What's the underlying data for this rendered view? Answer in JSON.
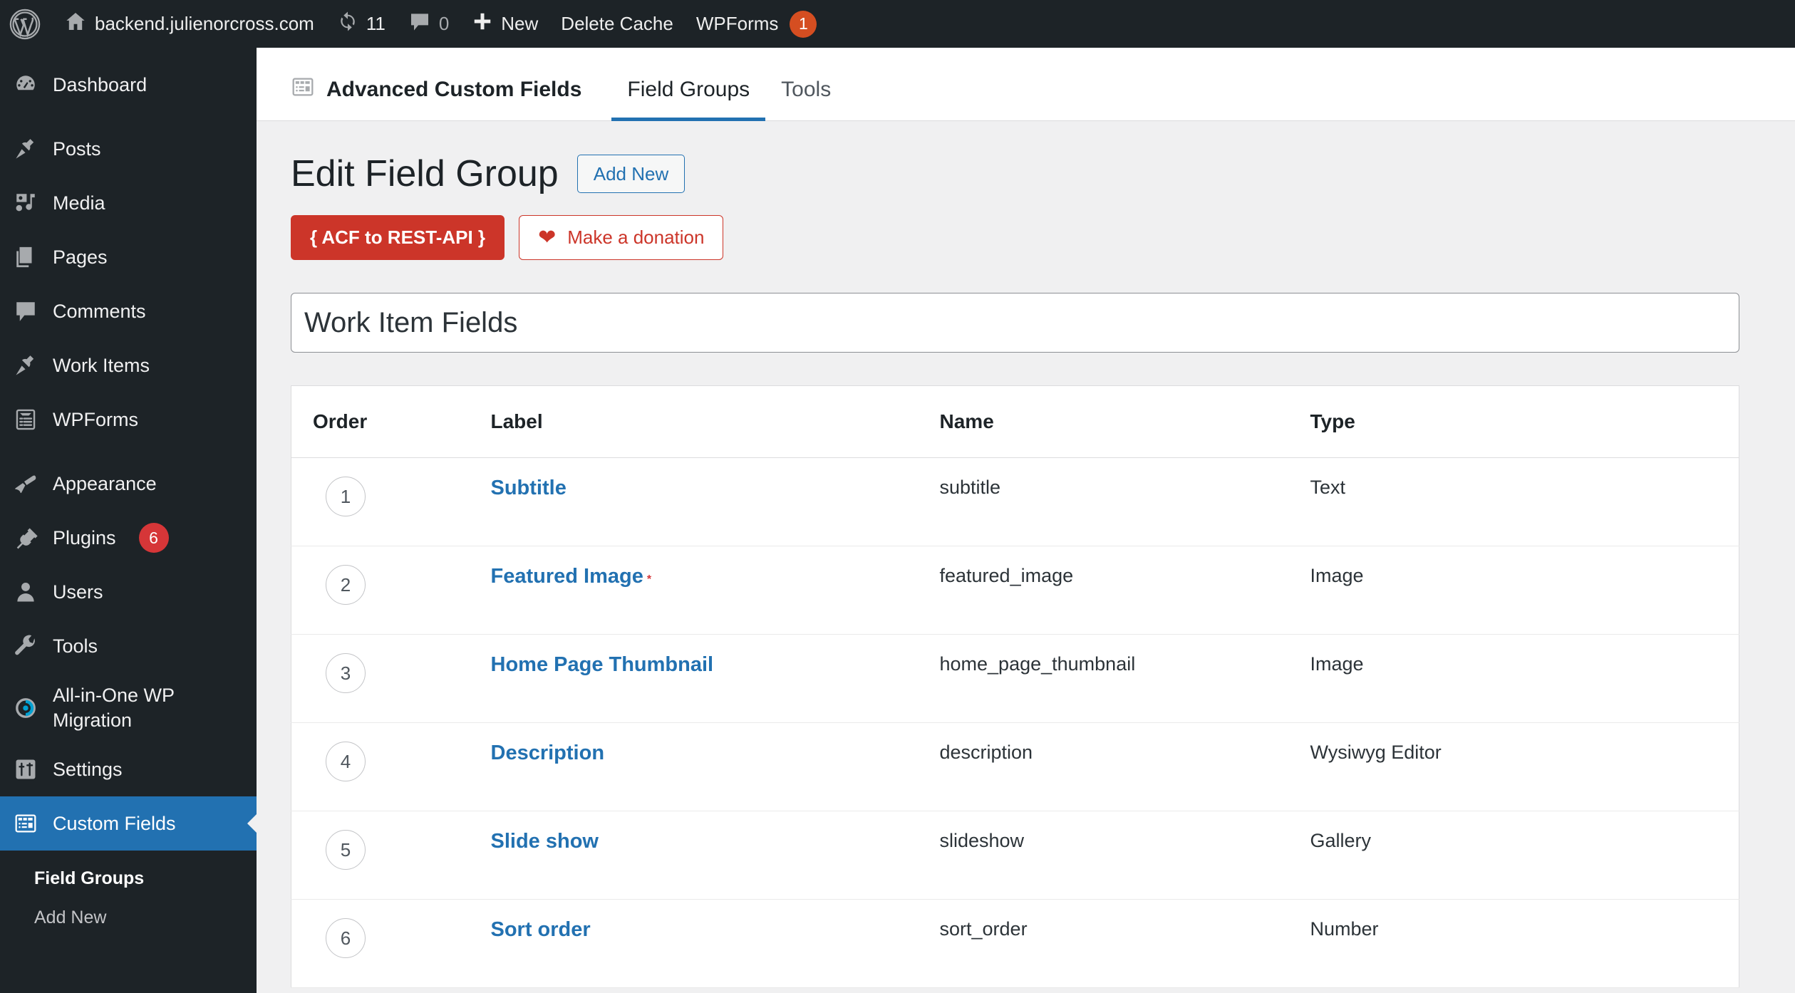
{
  "adminbar": {
    "wp_logo_icon": "wordpress-logo-icon",
    "site_home_icon": "home-icon",
    "site_name": "backend.julienorcross.com",
    "updates_icon": "updates-icon",
    "updates_count": "11",
    "comments_icon": "comment-bubble-icon",
    "comments_count": "0",
    "new_icon": "plus-icon",
    "new_label": "New",
    "delete_cache_label": "Delete Cache",
    "wpforms_label": "WPForms",
    "wpforms_badge": "1",
    "badge_color": "#d54e21"
  },
  "sidebar": {
    "items": [
      {
        "label": "Dashboard",
        "icon": "dashboard-gauge-icon"
      },
      {
        "label": "Posts",
        "icon": "pin-icon"
      },
      {
        "label": "Media",
        "icon": "media-icon"
      },
      {
        "label": "Pages",
        "icon": "pages-icon"
      },
      {
        "label": "Comments",
        "icon": "comment-bubble-icon"
      },
      {
        "label": "Work Items",
        "icon": "pin-icon"
      },
      {
        "label": "WPForms",
        "icon": "wpforms-clipboard-icon"
      },
      {
        "label": "Appearance",
        "icon": "paintbrush-icon"
      },
      {
        "label": "Plugins",
        "icon": "plug-icon",
        "badge": "6"
      },
      {
        "label": "Users",
        "icon": "user-icon"
      },
      {
        "label": "Tools",
        "icon": "wrench-icon"
      },
      {
        "label": "All-in-One WP Migration",
        "icon": "aiowpm-swirl-icon"
      },
      {
        "label": "Settings",
        "icon": "settings-sliders-icon"
      },
      {
        "label": "Custom Fields",
        "icon": "custom-fields-grid-icon",
        "current": true
      }
    ],
    "submenu": [
      {
        "label": "Field Groups",
        "active": true
      },
      {
        "label": "Add New",
        "active": false
      }
    ],
    "current_color": "#2271b1",
    "plugins_badge_color": "#d63638"
  },
  "acf_header": {
    "brand_icon": "acf-grid-icon",
    "brand": "Advanced Custom Fields",
    "tabs": [
      {
        "label": "Field Groups",
        "active": true
      },
      {
        "label": "Tools",
        "active": false
      }
    ],
    "active_tab_color": "#2271b1"
  },
  "page": {
    "title": "Edit Field Group",
    "add_new_label": "Add New",
    "rest_api_button": "{ ACF to REST-API }",
    "donation_icon": "heart-icon",
    "donation_label": "Make a donation",
    "rest_api_color": "#cc3529",
    "field_group_title": "Work Item Fields",
    "field_group_title_placeholder": "Add title"
  },
  "fields_table": {
    "headers": [
      "Order",
      "Label",
      "Name",
      "Type"
    ],
    "rows": [
      {
        "order": "1",
        "label": "Subtitle",
        "required": false,
        "name": "subtitle",
        "type": "Text"
      },
      {
        "order": "2",
        "label": "Featured Image",
        "required": true,
        "name": "featured_image",
        "type": "Image"
      },
      {
        "order": "3",
        "label": "Home Page Thumbnail",
        "required": false,
        "name": "home_page_thumbnail",
        "type": "Image"
      },
      {
        "order": "4",
        "label": "Description",
        "required": false,
        "name": "description",
        "type": "Wysiwyg Editor"
      },
      {
        "order": "5",
        "label": "Slide show",
        "required": false,
        "name": "slideshow",
        "type": "Gallery"
      },
      {
        "order": "6",
        "label": "Sort order",
        "required": false,
        "name": "sort_order",
        "type": "Number"
      }
    ],
    "required_marker": "*",
    "link_color": "#2271b1",
    "required_color": "#d63638"
  }
}
